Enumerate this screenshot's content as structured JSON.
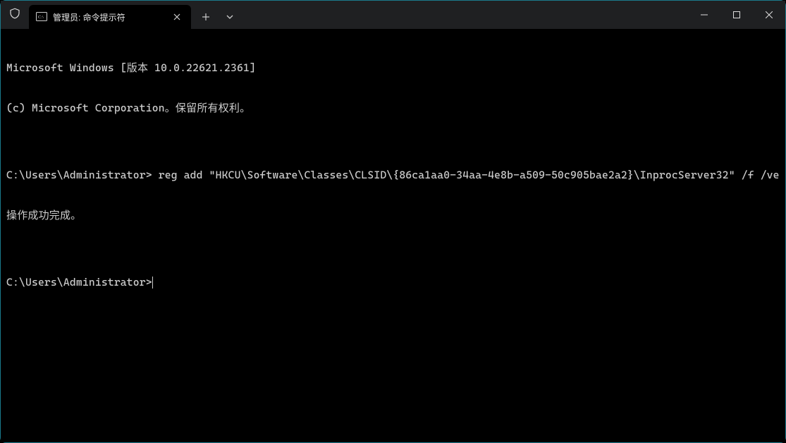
{
  "titlebar": {
    "tab": {
      "title": "管理员: 命令提示符"
    }
  },
  "terminal": {
    "lines": {
      "l0": "Microsoft Windows [版本 10.0.22621.2361]",
      "l1": "(c) Microsoft Corporation。保留所有权利。",
      "l2": "",
      "l3": "C:\\Users\\Administrator> reg add \"HKCU\\Software\\Classes\\CLSID\\{86ca1aa0-34aa-4e8b-a509-50c905bae2a2}\\InprocServer32\" /f /ve",
      "l4": "操作成功完成。",
      "l5": "",
      "l6": "C:\\Users\\Administrator>"
    }
  }
}
